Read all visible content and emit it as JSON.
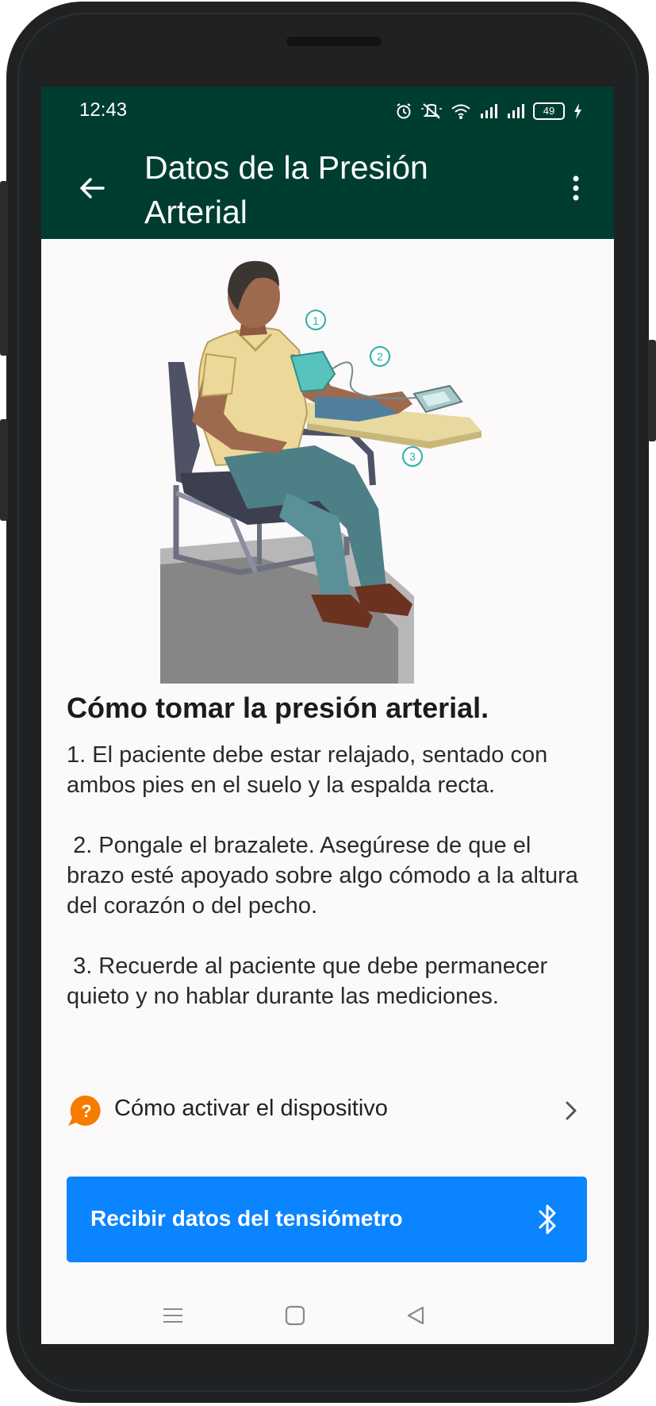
{
  "status_bar": {
    "time": "12:43",
    "battery": "49",
    "icons": [
      "alarm-icon",
      "mute-icon",
      "wifi-icon",
      "signal-icon",
      "signal-icon",
      "battery-icon",
      "charging-icon"
    ]
  },
  "app_bar": {
    "title": "Datos de la Presión Arterial",
    "back_icon": "arrow-left-icon",
    "menu_icon": "more-vertical-icon"
  },
  "illustration": {
    "markers": [
      "1",
      "2",
      "3"
    ]
  },
  "content": {
    "heading": "Cómo tomar la presión arterial.",
    "instructions": "1. El paciente debe estar relajado, sentado con ambos pies en el suelo y la espalda recta.\n\n 2. Pongale el brazalete. Asegúrese de que el brazo esté apoyado sobre algo cómodo a la altura del corazón o del pecho.\n\n 3. Recuerde al paciente que debe permanecer quieto y no hablar durante las mediciones."
  },
  "help_link": {
    "icon_glyph": "?",
    "label": "Cómo activar el dispositivo"
  },
  "primary_button": {
    "label": "Recibir datos del tensiómetro",
    "icon": "bluetooth-icon"
  },
  "colors": {
    "app_bar": "#003d31",
    "button": "#0a84ff",
    "help_icon": "#f57c00",
    "background": "#fcf9fb"
  }
}
